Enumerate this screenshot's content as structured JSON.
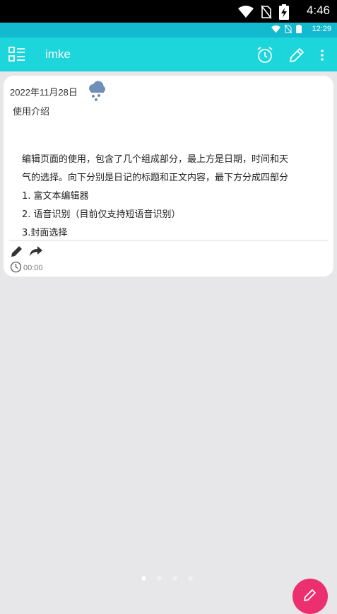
{
  "system_status": {
    "time": "4:46"
  },
  "app_status": {
    "time": "12:29"
  },
  "appbar": {
    "title": "imke"
  },
  "entry": {
    "date": "2022年11月28日",
    "weather_icon": "snow-cloud-icon",
    "title": "使用介绍",
    "content_lines": [
      "编辑页面的使用，包含了几个组成部分，最上方是日期，时间和天",
      "气的选择。向下分别是日记的标题和正文内容，最下方分成四部分",
      "1. 富文本编辑器",
      "2. 语音识别（目前仅支持短语音识别）",
      "3.封面选择"
    ],
    "time": "00:00"
  },
  "pager": {
    "count": 4,
    "active_index": 0
  },
  "colors": {
    "appbar": "#1cd6dc",
    "status_inner": "#12b9cf",
    "fab": "#ec2f6f",
    "background": "#e7e6e8"
  }
}
